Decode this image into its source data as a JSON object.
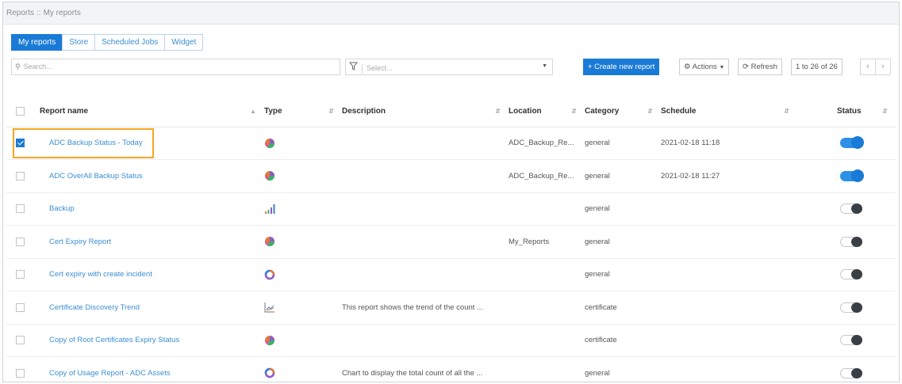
{
  "breadcrumb": {
    "root": "Reports",
    "separator": "::",
    "current": "My reports"
  },
  "tabs": [
    {
      "label": "My reports",
      "active": true
    },
    {
      "label": "Store",
      "active": false
    },
    {
      "label": "Scheduled Jobs",
      "active": false
    },
    {
      "label": "Widget",
      "active": false
    }
  ],
  "toolbar": {
    "search_placeholder": "Search...",
    "filter_placeholder": "Select...",
    "create_label": "+ Create new report",
    "actions_label": "Actions",
    "refresh_label": "Refresh",
    "pagination": "1 to 26 of 26"
  },
  "table": {
    "columns": [
      "Report name",
      "Type",
      "Description",
      "Location",
      "Category",
      "Schedule",
      "Status"
    ],
    "rows": [
      {
        "name": "ADC Backup Status - Today",
        "type": "pie-chart-icon",
        "description": "",
        "location": "ADC_Backup_Re...",
        "category": "general",
        "schedule": "2021-02-18 11:18",
        "status": "on",
        "checked": true
      },
      {
        "name": "ADC OverAll Backup Status",
        "type": "pie-chart-icon",
        "description": "",
        "location": "ADC_Backup_Re...",
        "category": "general",
        "schedule": "2021-02-18 11:27",
        "status": "on",
        "checked": false
      },
      {
        "name": "Backup",
        "type": "bar-chart-icon",
        "description": "",
        "location": "",
        "category": "general",
        "schedule": "",
        "status": "off",
        "checked": false
      },
      {
        "name": "Cert Expiry Report",
        "type": "pie-chart-icon",
        "description": "",
        "location": "My_Reports",
        "category": "general",
        "schedule": "",
        "status": "off",
        "checked": false
      },
      {
        "name": "Cert expiry with create incident",
        "type": "donut-chart-icon",
        "description": "",
        "location": "",
        "category": "general",
        "schedule": "",
        "status": "off",
        "checked": false
      },
      {
        "name": "Certificate Discovery Trend",
        "type": "line-chart-icon",
        "description": "This report shows the trend of the count ...",
        "location": "",
        "category": "certificate",
        "schedule": "",
        "status": "off",
        "checked": false
      },
      {
        "name": "Copy of Root Certificates Expiry Status",
        "type": "pie-chart-icon",
        "description": "",
        "location": "",
        "category": "certificate",
        "schedule": "",
        "status": "off",
        "checked": false
      },
      {
        "name": "Copy of Usage Report - ADC Assets",
        "type": "donut-chart-icon",
        "description": "Chart to display the total count of all the ...",
        "location": "",
        "category": "general",
        "schedule": "",
        "status": "off",
        "checked": false
      }
    ]
  },
  "colors": {
    "accent": "#1a7bd6",
    "link": "#3a8ed4",
    "highlight": "#f5a623",
    "toggle_off_knob": "#3a3f46"
  }
}
